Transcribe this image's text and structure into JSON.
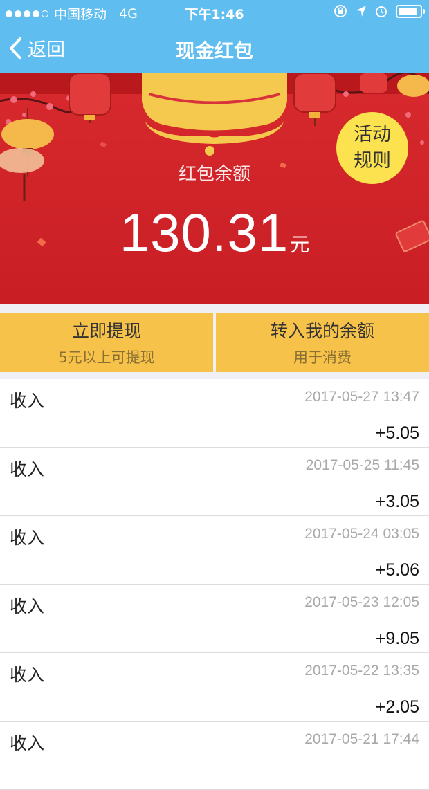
{
  "status_bar": {
    "carrier": "中国移动",
    "network": "4G",
    "time": "下午1:46"
  },
  "nav": {
    "back_label": "返回",
    "title": "现金红包"
  },
  "banner": {
    "balance_label": "红包余额",
    "balance_value": "130.31",
    "balance_unit": "元",
    "rules_line1": "活动",
    "rules_line2": "规则"
  },
  "actions": {
    "withdraw_main": "立即提现",
    "withdraw_sub": "5元以上可提现",
    "transfer_main": "转入我的余额",
    "transfer_sub": "用于消费"
  },
  "records": [
    {
      "type": "收入",
      "date": "2017-05-27 13:47",
      "amount": "+5.05"
    },
    {
      "type": "收入",
      "date": "2017-05-25 11:45",
      "amount": "+3.05"
    },
    {
      "type": "收入",
      "date": "2017-05-24 03:05",
      "amount": "+5.06"
    },
    {
      "type": "收入",
      "date": "2017-05-23 12:05",
      "amount": "+9.05"
    },
    {
      "type": "收入",
      "date": "2017-05-22 13:35",
      "amount": "+2.05"
    },
    {
      "type": "收入",
      "date": "2017-05-21 17:44",
      "amount": ""
    }
  ],
  "colors": {
    "nav_blue": "#5fbdf0",
    "banner_red": "#d82a2e",
    "button_yellow": "#f6c24a",
    "rules_yellow": "#fde24f"
  }
}
